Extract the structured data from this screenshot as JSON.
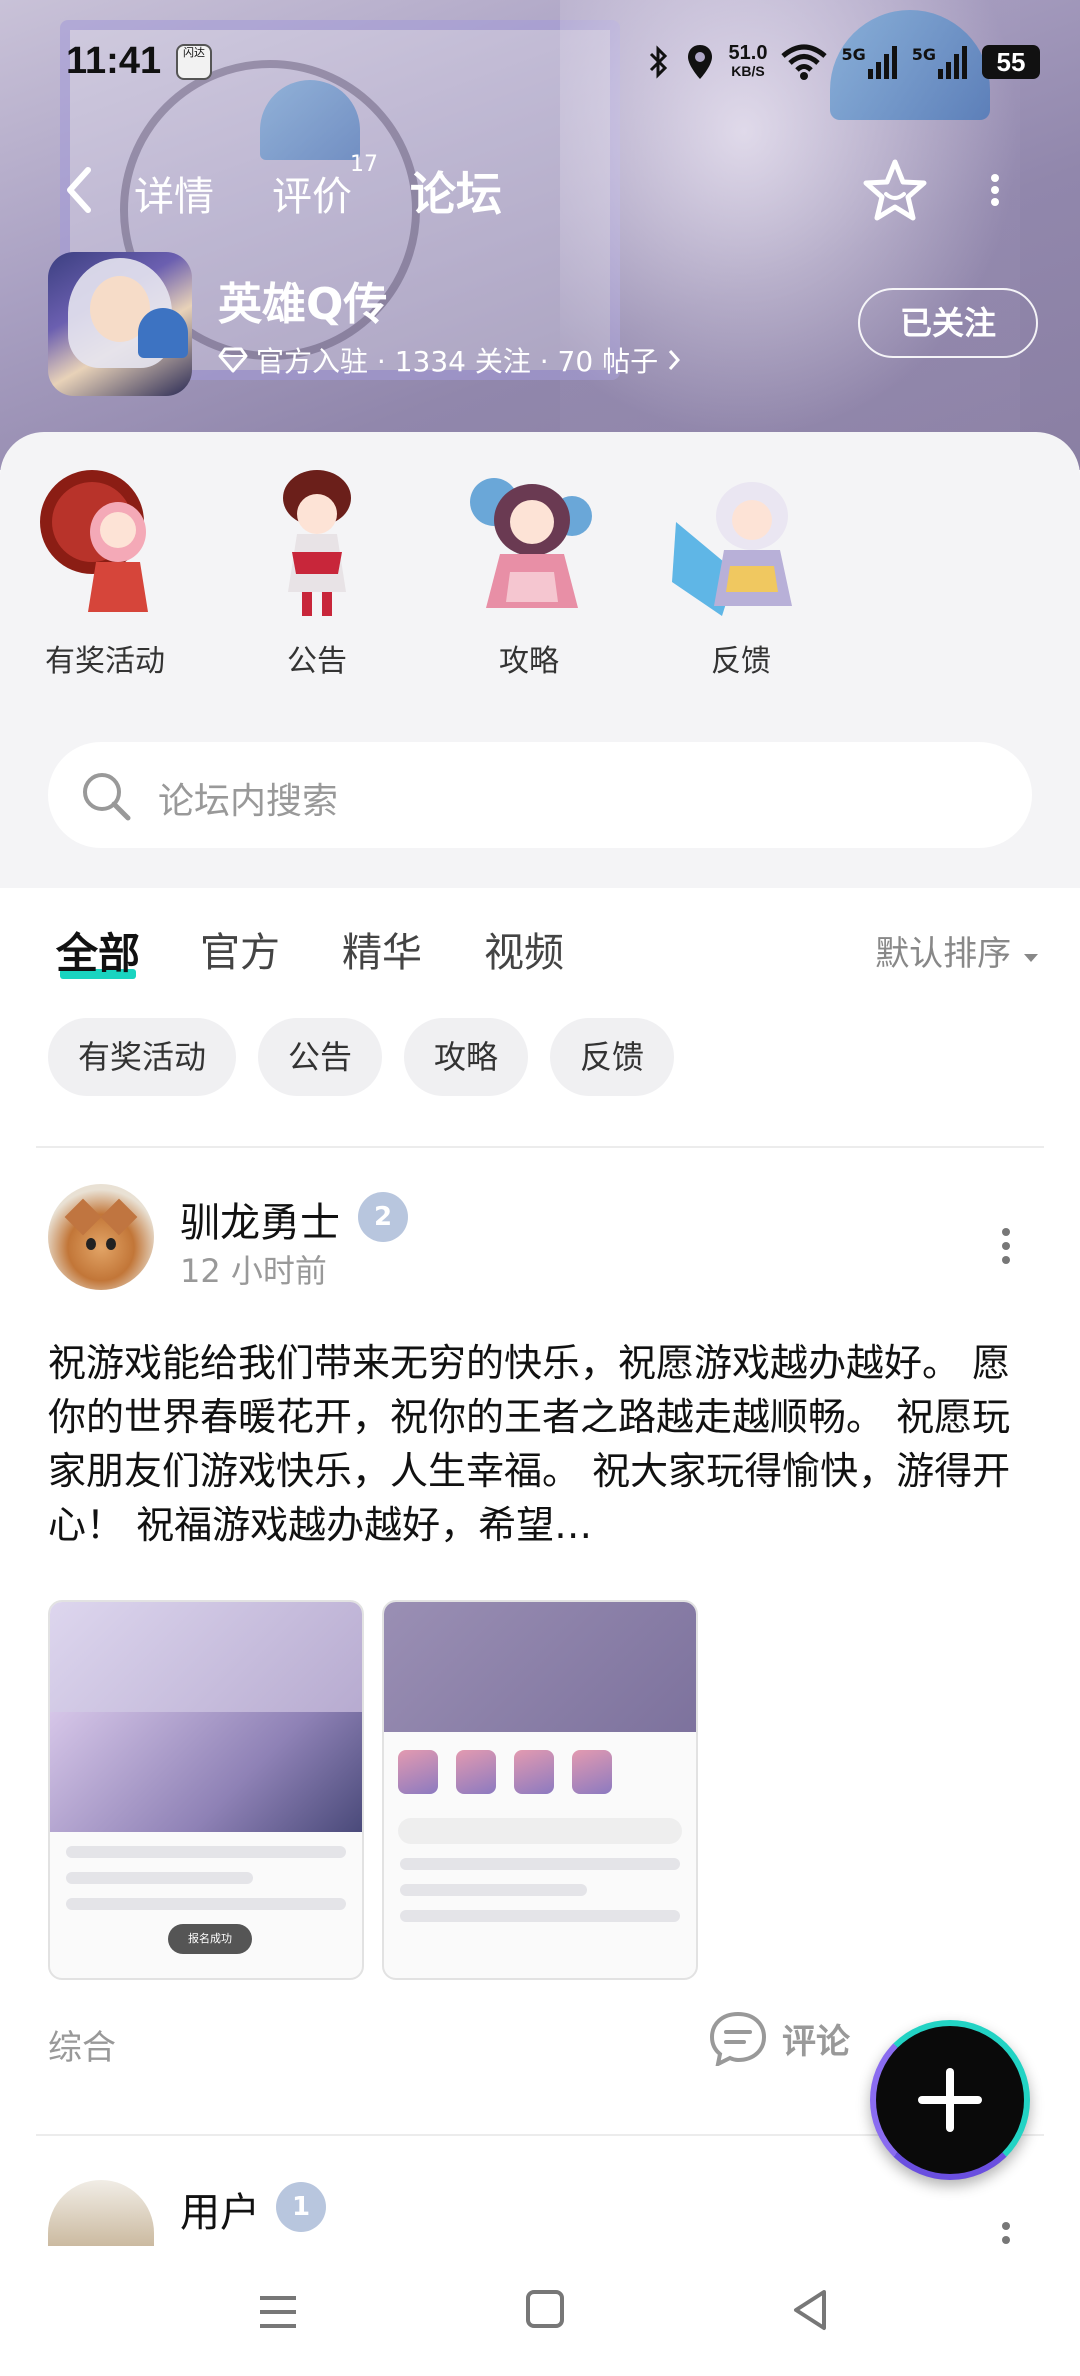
{
  "status_bar": {
    "time": "11:41",
    "app_icon_text": "闪达",
    "net_speed_value": "51.0",
    "net_speed_unit": "KB/S",
    "signal1": "5G",
    "signal2": "5G",
    "battery": "55"
  },
  "nav": {
    "tabs": [
      {
        "label": "详情"
      },
      {
        "label": "评价"
      },
      {
        "label": "论坛"
      }
    ],
    "review_count": "17",
    "active_tab": "论坛"
  },
  "game": {
    "name": "英雄Q传",
    "meta": "官方入驻 · 1334 关注 · 70 帖子",
    "follow_label": "已关注"
  },
  "categories": [
    {
      "label": "有奖活动"
    },
    {
      "label": "公告"
    },
    {
      "label": "攻略"
    },
    {
      "label": "反馈"
    }
  ],
  "search": {
    "placeholder": "论坛内搜索"
  },
  "filter_tabs": [
    {
      "label": "全部"
    },
    {
      "label": "官方"
    },
    {
      "label": "精华"
    },
    {
      "label": "视频"
    }
  ],
  "sort_label": "默认排序",
  "chips": [
    {
      "label": "有奖活动"
    },
    {
      "label": "公告"
    },
    {
      "label": "攻略"
    },
    {
      "label": "反馈"
    }
  ],
  "posts": [
    {
      "author": "驯龙勇士",
      "level": "2",
      "time": "12 小时前",
      "text": "祝游戏能给我们带来无穷的快乐，祝愿游戏越办越好。 愿你的世界春暖花开，祝你的王者之路越走越顺畅。 祝愿玩家朋友们游戏快乐，人生幸福。 祝大家玩得愉快，游得开心！ 祝福游戏越办越好，希望…",
      "shot1_pill": "报名成功",
      "category": "综合",
      "comment_label": "评论"
    },
    {
      "author": "用户",
      "level": "1"
    }
  ],
  "colors": {
    "accent": "#19d4c0",
    "banner": "#9a90b5"
  },
  "icons": [
    "back-icon",
    "star-icon",
    "more-icon",
    "diamond-icon",
    "search-icon",
    "comment-icon",
    "plus-icon",
    "menu-icon",
    "home-icon",
    "back-triangle-icon"
  ]
}
